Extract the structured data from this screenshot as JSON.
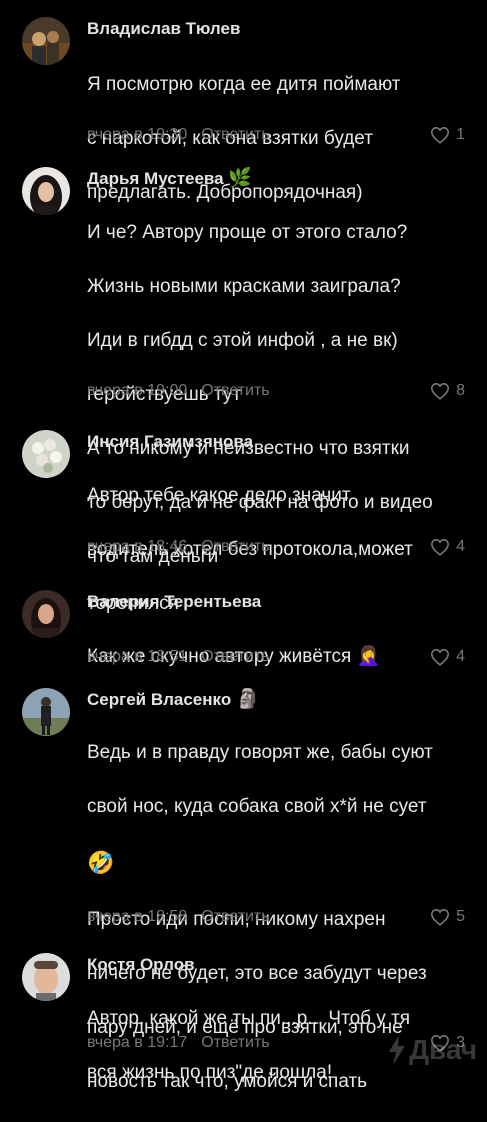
{
  "comments": [
    {
      "author": "Владислав Тюлев",
      "lines": [
        "Я посмотрю когда ее дитя поймают",
        "с наркотой, как она взятки будет",
        "предлагать. Добропорядочная)"
      ],
      "time": "вчера в 19:30",
      "reply": "Ответить",
      "likes": "1"
    },
    {
      "author": "Дарья Мустеева",
      "author_emoji": "🌿",
      "lines": [
        "И че? Автору проще от этого стало?",
        "Жизнь новыми красками заиграла?",
        "Иди в гибдд с этой инфой , а не вк)",
        "геройствуешь тут",
        "А то никому и неизвестно что взятки",
        "то берут, да и не факт на фото и видео",
        "что там деньги"
      ],
      "time": "вчера в 19:00",
      "reply": "Ответить",
      "likes": "8"
    },
    {
      "author": "Инсия Газимзянова",
      "lines": [
        "Автор тебе какое дело значит",
        "водитель хотел без протокола,может",
        "торопился"
      ],
      "time": "вчера в 18:46",
      "reply": "Ответить",
      "likes": "4"
    },
    {
      "author": "Валерия Терентьева",
      "lines": [
        "Как же скучно автору живётся"
      ],
      "line_emoji": "🤦‍♀️",
      "time": "вчера в 18:51",
      "reply": "Ответить",
      "likes": "4"
    },
    {
      "author": "Сергей Власенко",
      "author_emoji": "🗿",
      "lines": [
        "Ведь и в правду говорят же, бабы суют",
        "свой нос, куда собака свой х*й не сует",
        "🤣",
        "Просто иди поспи, никому нахрен",
        "ничего не будет, это все забудут через",
        "пару дней, и ещё про взятки, это не",
        "новость так что, умойся и спать"
      ],
      "time": "вчера в 18:58",
      "reply": "Ответить",
      "likes": "5"
    },
    {
      "author": "Костя Орлов",
      "lines": [
        "Автор, какой же ты пи...р... Чтоб у тя",
        "вся жизнь по пиз\"де пошла!"
      ],
      "time": "вчера в 19:17",
      "reply": "Ответить",
      "likes": "3"
    }
  ],
  "watermark": "Двач",
  "icons": {
    "like": "heart-outline-icon",
    "watermark_logo": "lightning-icon"
  },
  "colors": {
    "background": "#000000",
    "text": "#e1e3e6",
    "muted": "#76787a"
  }
}
